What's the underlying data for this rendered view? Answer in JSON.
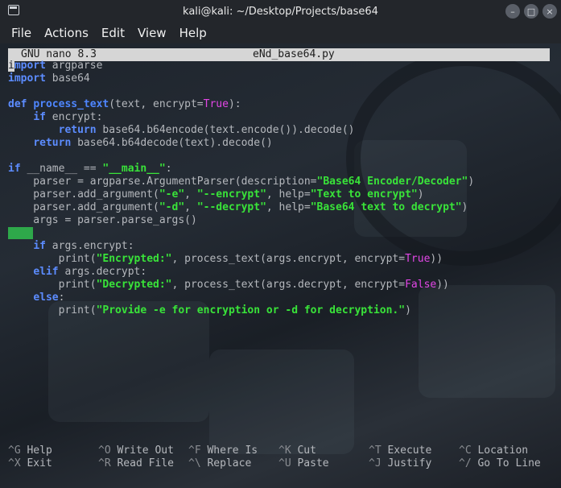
{
  "window": {
    "title": "kali@kali: ~/Desktop/Projects/base64",
    "buttons": [
      "–",
      "□",
      "×"
    ]
  },
  "menu": [
    "File",
    "Actions",
    "Edit",
    "View",
    "Help"
  ],
  "nano": {
    "version": "GNU nano 8.3",
    "filename": "eNd_base64.py"
  },
  "code_lines": [
    [
      {
        "t": "i",
        "c": "cursor"
      },
      {
        "t": "mport",
        "c": "kw"
      },
      {
        "t": " argparse",
        "c": "p"
      }
    ],
    [
      {
        "t": "import",
        "c": "kw"
      },
      {
        "t": " base64",
        "c": "p"
      }
    ],
    [],
    [
      {
        "t": "def",
        "c": "kw"
      },
      {
        "t": " ",
        "c": "p"
      },
      {
        "t": "process_text",
        "c": "fn"
      },
      {
        "t": "(text, encrypt=",
        "c": "p"
      },
      {
        "t": "True",
        "c": "bi"
      },
      {
        "t": "):",
        "c": "p"
      }
    ],
    [
      {
        "t": "    ",
        "c": "p"
      },
      {
        "t": "if",
        "c": "kw"
      },
      {
        "t": " encrypt:",
        "c": "p"
      }
    ],
    [
      {
        "t": "        ",
        "c": "p"
      },
      {
        "t": "return",
        "c": "kw"
      },
      {
        "t": " base64.b64encode(text.encode()).decode()",
        "c": "p"
      }
    ],
    [
      {
        "t": "    ",
        "c": "p"
      },
      {
        "t": "return",
        "c": "kw"
      },
      {
        "t": " base64.b64decode(text).decode()",
        "c": "p"
      }
    ],
    [],
    [
      {
        "t": "if",
        "c": "kw"
      },
      {
        "t": " __name__ == ",
        "c": "p"
      },
      {
        "t": "\"__main__\"",
        "c": "str"
      },
      {
        "t": ":",
        "c": "p"
      }
    ],
    [
      {
        "t": "    parser = argparse.ArgumentParser(description=",
        "c": "p"
      },
      {
        "t": "\"Base64 Encoder/Decoder\"",
        "c": "str"
      },
      {
        "t": ")",
        "c": "p"
      }
    ],
    [
      {
        "t": "    parser.add_argument(",
        "c": "p"
      },
      {
        "t": "\"-e\"",
        "c": "str"
      },
      {
        "t": ", ",
        "c": "p"
      },
      {
        "t": "\"--encrypt\"",
        "c": "str"
      },
      {
        "t": ", help=",
        "c": "p"
      },
      {
        "t": "\"Text to encrypt\"",
        "c": "str"
      },
      {
        "t": ")",
        "c": "p"
      }
    ],
    [
      {
        "t": "    parser.add_argument(",
        "c": "p"
      },
      {
        "t": "\"-d\"",
        "c": "str"
      },
      {
        "t": ", ",
        "c": "p"
      },
      {
        "t": "\"--decrypt\"",
        "c": "str"
      },
      {
        "t": ", help=",
        "c": "p"
      },
      {
        "t": "\"Base64 text to decrypt\"",
        "c": "str"
      },
      {
        "t": ")",
        "c": "p"
      }
    ],
    [
      {
        "t": "    args = parser.parse_args()",
        "c": "p"
      }
    ],
    [
      {
        "t": "    ",
        "c": "hl"
      }
    ],
    [
      {
        "t": "    ",
        "c": "p"
      },
      {
        "t": "if",
        "c": "kw"
      },
      {
        "t": " args.encrypt:",
        "c": "p"
      }
    ],
    [
      {
        "t": "        print(",
        "c": "p"
      },
      {
        "t": "\"Encrypted:\"",
        "c": "str"
      },
      {
        "t": ", process_text(args.encrypt, encrypt=",
        "c": "p"
      },
      {
        "t": "True",
        "c": "bi"
      },
      {
        "t": "))",
        "c": "p"
      }
    ],
    [
      {
        "t": "    ",
        "c": "p"
      },
      {
        "t": "elif",
        "c": "kw"
      },
      {
        "t": " args.decrypt:",
        "c": "p"
      }
    ],
    [
      {
        "t": "        print(",
        "c": "p"
      },
      {
        "t": "\"Decrypted:\"",
        "c": "str"
      },
      {
        "t": ", process_text(args.decrypt, encrypt=",
        "c": "p"
      },
      {
        "t": "False",
        "c": "bi"
      },
      {
        "t": "))",
        "c": "p"
      }
    ],
    [
      {
        "t": "    ",
        "c": "p"
      },
      {
        "t": "else",
        "c": "kw"
      },
      {
        "t": ":",
        "c": "p"
      }
    ],
    [
      {
        "t": "        print(",
        "c": "p"
      },
      {
        "t": "\"Provide -e for encryption or -d for decryption.\"",
        "c": "str"
      },
      {
        "t": ")",
        "c": "p"
      }
    ]
  ],
  "shortcuts": [
    {
      "key": "^G",
      "label": "Help"
    },
    {
      "key": "^X",
      "label": "Exit"
    },
    {
      "key": "^O",
      "label": "Write Out"
    },
    {
      "key": "^R",
      "label": "Read File"
    },
    {
      "key": "^F",
      "label": "Where Is"
    },
    {
      "key": "^\\",
      "label": "Replace"
    },
    {
      "key": "^K",
      "label": "Cut"
    },
    {
      "key": "^U",
      "label": "Paste"
    },
    {
      "key": "^T",
      "label": "Execute"
    },
    {
      "key": "^J",
      "label": "Justify"
    },
    {
      "key": "^C",
      "label": "Location"
    },
    {
      "key": "^/",
      "label": "Go To Line"
    }
  ]
}
